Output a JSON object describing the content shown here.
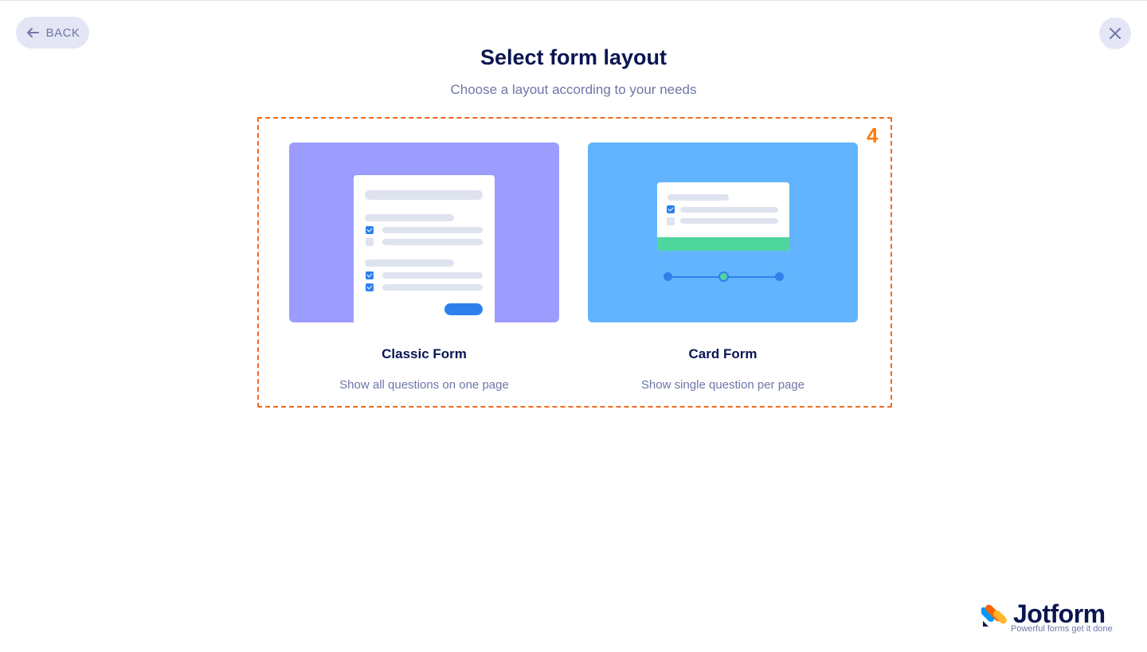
{
  "header": {
    "back_label": "BACK",
    "title": "Select form layout",
    "subtitle": "Choose a layout according to your needs"
  },
  "annotation": {
    "marker_number": "4"
  },
  "options": [
    {
      "title": "Classic Form",
      "description": "Show all questions on one page",
      "thumb_color": "#9c9cff"
    },
    {
      "title": "Card Form",
      "description": "Show single question per page",
      "thumb_color": "#62b4ff"
    }
  ],
  "brand": {
    "name": "Jotform",
    "tagline": "Powerful forms get it done"
  },
  "icons": {
    "back": "arrow-left-icon",
    "close": "close-icon",
    "logo": "jotform-logo-icon"
  },
  "colors": {
    "accent": "#2f80ed",
    "annotation": "#f06a1d",
    "green": "#4fd69e"
  }
}
